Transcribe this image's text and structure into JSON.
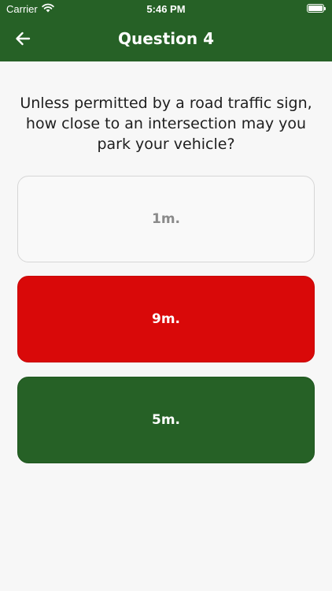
{
  "status_bar": {
    "carrier": "Carrier",
    "time": "5:46 PM"
  },
  "header": {
    "title": "Question 4",
    "back_icon": "arrow-left-icon"
  },
  "question": {
    "text": "Unless permitted by a road traffic sign, how close to an intersection may you park your vehicle?"
  },
  "answers": [
    {
      "label": "1m.",
      "state": "default"
    },
    {
      "label": "9m.",
      "state": "incorrect"
    },
    {
      "label": "5m.",
      "state": "correct"
    }
  ],
  "colors": {
    "primary_green": "#266126",
    "incorrect_red": "#d90909",
    "background": "#f7f7f7"
  }
}
